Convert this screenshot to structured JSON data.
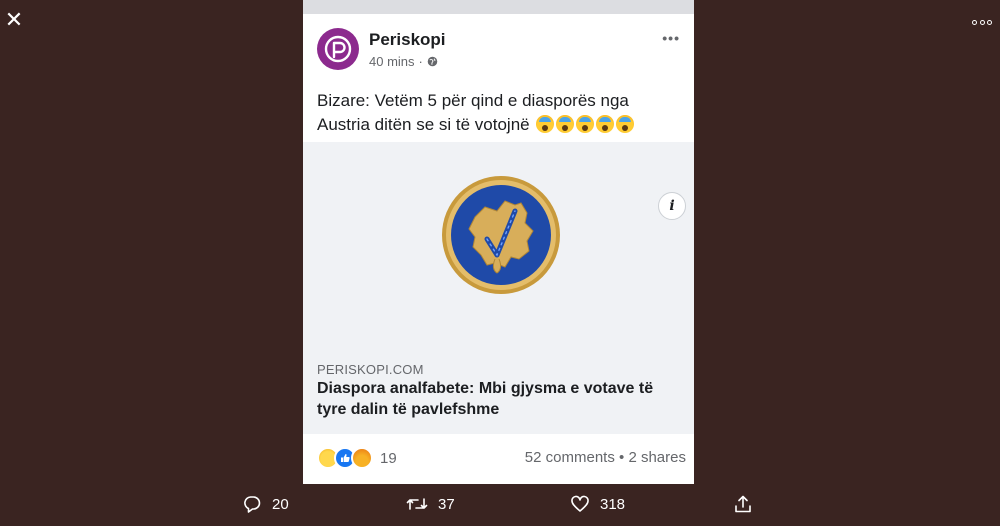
{
  "viewer": {
    "close_icon": "close-icon",
    "more_icon": "more-icon"
  },
  "post": {
    "page_name": "Periskopi",
    "time": "40 mins",
    "privacy_icon": "globe-icon",
    "text": "Bizare: Vetëm 5 për qind e diasporës nga Austria ditën se si të votojnë",
    "text_emojis": [
      "😱",
      "😱",
      "😱",
      "😱",
      "😱"
    ],
    "link": {
      "domain": "PERISKOPI.COM",
      "headline": "Diaspora analfabete: Mbi gjysma e votave të tyre dalin të pavlefshme"
    },
    "reactions": {
      "types": [
        "haha",
        "like",
        "angry"
      ],
      "count": "19"
    },
    "comments": "52 comments",
    "separator": "•",
    "shares": "2 shares"
  },
  "actions": {
    "reply_count": "20",
    "retweet_count": "37",
    "like_count": "318"
  },
  "colors": {
    "background": "#3a2421",
    "brand": "#8c2a8e",
    "seal_blue": "#1f4aa8",
    "seal_gold": "#d4a64a"
  }
}
